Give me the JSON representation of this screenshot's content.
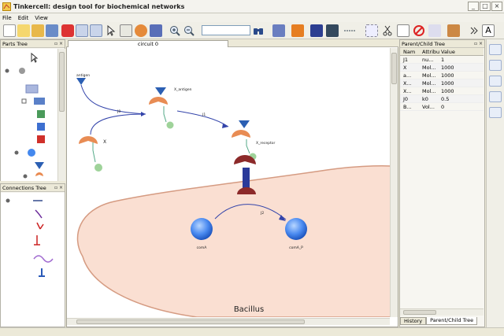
{
  "window": {
    "title": "Tinkercell: design tool for biochemical networks"
  },
  "menu": {
    "items": [
      "File",
      "Edit",
      "View"
    ]
  },
  "toolbar": {
    "search_value": ""
  },
  "parts_tree": {
    "title": "Parts Tree"
  },
  "connections_tree": {
    "title": "Connections Tree"
  },
  "canvas": {
    "tab_label": "circuit 0",
    "labels": {
      "antigen": "antigen",
      "x": "X",
      "x_antigen": "X_antigen",
      "x_receptor": "X_receptor",
      "j0": "J0",
      "j1": "J1",
      "j2": "J2",
      "coma": "comA",
      "coma_p": "comA_P",
      "bacillus": "Bacillus"
    }
  },
  "parent_child": {
    "title": "Parent/Child Tree",
    "headers": [
      "Nam",
      "Attribu",
      "Value"
    ],
    "rows": [
      {
        "name": "J1",
        "attr": "nu...",
        "value": "1"
      },
      {
        "name": "X",
        "attr": "Mol...",
        "value": "1000"
      },
      {
        "name": "a...",
        "attr": "Mol...",
        "value": "1000"
      },
      {
        "name": "X...",
        "attr": "Mol...",
        "value": "1000"
      },
      {
        "name": "X...",
        "attr": "Mol...",
        "value": "1000"
      },
      {
        "name": "J0",
        "attr": "k0",
        "value": "0.5"
      },
      {
        "name": "B...",
        "attr": "Vol...",
        "value": "0"
      }
    ],
    "tabs": [
      "History",
      "Parent/Child Tree"
    ]
  }
}
